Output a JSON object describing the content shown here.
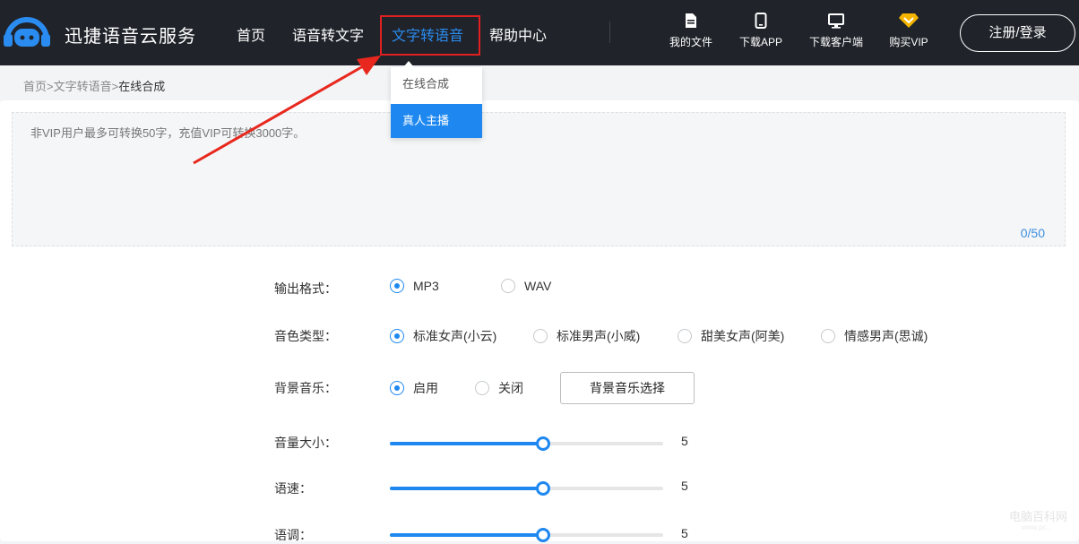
{
  "header": {
    "brand": "迅捷语音云服务",
    "nav": [
      "首页",
      "语音转文字",
      "文字转语音",
      "帮助中心"
    ],
    "active_nav": "文字转语音",
    "tools": [
      {
        "label": "我的文件",
        "icon": "file-icon"
      },
      {
        "label": "下载APP",
        "icon": "phone-icon"
      },
      {
        "label": "下载客户端",
        "icon": "monitor-icon"
      },
      {
        "label": "购买VIP",
        "icon": "vip-diamond-icon"
      }
    ],
    "login": "注册/登录"
  },
  "dropdown": {
    "items": [
      "在线合成",
      "真人主播"
    ],
    "selected": "真人主播"
  },
  "breadcrumb": {
    "links": [
      "首页",
      "文字转语音"
    ],
    "separator": ">",
    "current": "在线合成"
  },
  "editor": {
    "placeholder": "非VIP用户最多可转换50字，充值VIP可转换3000字。",
    "counter": "0/50"
  },
  "settings": {
    "format": {
      "label": "输出格式：",
      "options": [
        "MP3",
        "WAV"
      ],
      "selected": "MP3"
    },
    "voice": {
      "label": "音色类型：",
      "options": [
        "标准女声(小云)",
        "标准男声(小威)",
        "甜美女声(阿美)",
        "情感男声(思诚)"
      ],
      "selected": "标准女声(小云)"
    },
    "bgm": {
      "label": "背景音乐：",
      "options": [
        "启用",
        "关闭"
      ],
      "selected": "启用",
      "button": "背景音乐选择"
    },
    "volume": {
      "label": "音量大小：",
      "value": "5",
      "level": 0.56
    },
    "speed": {
      "label": "语速：",
      "value": "5",
      "level": 0.56
    },
    "pitch": {
      "label": "语调：",
      "value": "5",
      "level": 0.56
    }
  },
  "watermark": {
    "text": "电脑百科网",
    "sub": "www.pc..."
  },
  "colors": {
    "accent": "#1e88f0",
    "header_bg": "#20232a",
    "highlight_box": "#e02020",
    "arrow": "#e8281e"
  }
}
